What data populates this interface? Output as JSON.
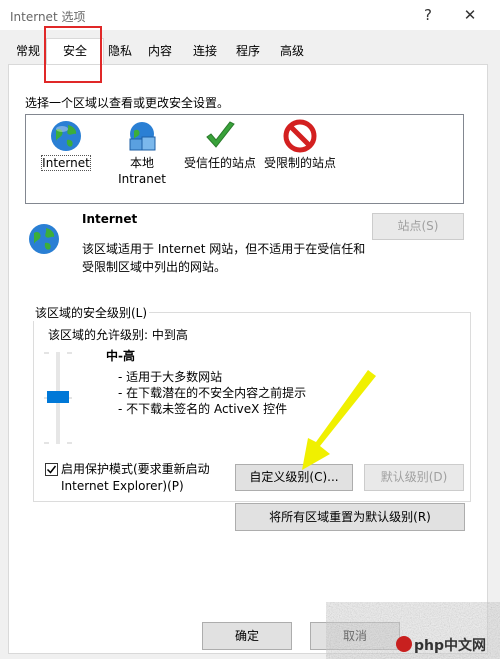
{
  "window": {
    "title": "Internet 选项",
    "help_glyph": "?",
    "close_glyph": "✕"
  },
  "tabs": [
    {
      "label": "常规",
      "active": false
    },
    {
      "label": "安全",
      "active": true
    },
    {
      "label": "隐私",
      "active": false
    },
    {
      "label": "内容",
      "active": false
    },
    {
      "label": "连接",
      "active": false
    },
    {
      "label": "程序",
      "active": false
    },
    {
      "label": "高级",
      "active": false
    }
  ],
  "security": {
    "instruction": "选择一个区域以查看或更改安全设置。",
    "zones": [
      {
        "label_line1": "Internet",
        "label_line2": "",
        "icon": "globe-icon",
        "selected": true
      },
      {
        "label_line1": "本地",
        "label_line2": "Intranet",
        "icon": "local-intranet-icon",
        "selected": false
      },
      {
        "label_line1": "受信任的站点",
        "label_line2": "",
        "icon": "trusted-check-icon",
        "selected": false
      },
      {
        "label_line1": "受限制的站点",
        "label_line2": "",
        "icon": "restricted-icon",
        "selected": false
      }
    ],
    "detail": {
      "title": "Internet",
      "description": "该区域适用于 Internet 网站，但不适用于在受信任和受限制区域中列出的网站。",
      "sites_button": "站点(S)"
    },
    "level": {
      "group_label": "该区域的安全级别(L)",
      "allowed_label": "该区域的允许级别: 中到高",
      "level_title": "中-高",
      "level_value": "中-高",
      "points": [
        "- 适用于大多数网站",
        "- 在下载潜在的不安全内容之前提示",
        "- 不下载未签名的 ActiveX 控件"
      ],
      "protected_mode_line1": "启用保护模式(要求重新启动",
      "protected_mode_line2": "Internet Explorer)(P)",
      "protected_mode_checked": true,
      "custom_button": "自定义级别(C)...",
      "default_button": "默认级别(D)"
    },
    "reset_button": "将所有区域重置为默认级别(R)"
  },
  "footer": {
    "ok_button": "确定",
    "cancel_button": "取消"
  },
  "watermark": {
    "text": "php中文网"
  },
  "colors": {
    "highlight": "#e02828",
    "arrow": "#f0f000",
    "slider": "#0078d7"
  }
}
